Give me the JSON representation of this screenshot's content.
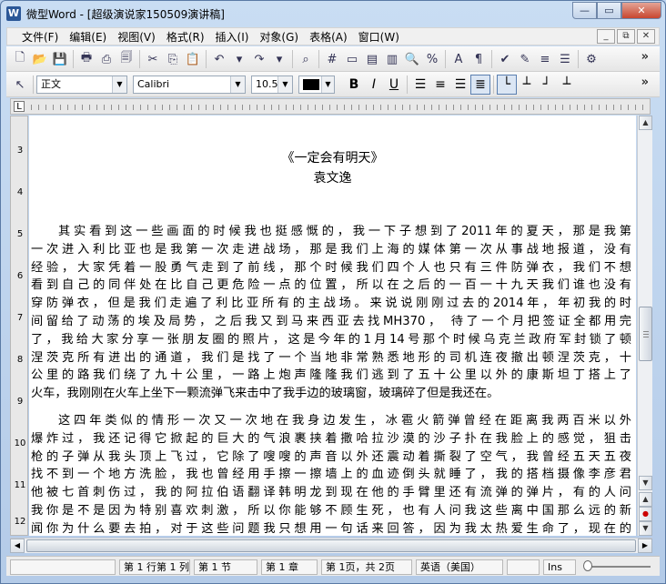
{
  "window": {
    "app_icon": "W",
    "title": "微型Word - [超级演说家150509演讲稿]",
    "controls": {
      "minimize": "—",
      "maximize": "▭",
      "close": "✕"
    }
  },
  "menu": {
    "items": [
      "文件(F)",
      "编辑(E)",
      "视图(V)",
      "格式(R)",
      "插入(I)",
      "对象(G)",
      "表格(A)",
      "窗口(W)"
    ],
    "doc_controls": [
      "_",
      "⧉",
      "✕"
    ]
  },
  "toolbar": {
    "more": "»",
    "style": "正文",
    "font": "Calibri",
    "font_size": "10.5",
    "bold": "B",
    "italic": "I",
    "underline": "U",
    "text_color": "#000000"
  },
  "document": {
    "title": "《一定会有明天》",
    "author": "袁文逸",
    "para1_lines": [
      "其实看到这一些画面的时候我也挺感慨的，我一下子想到了2011年的夏天，那是我第",
      "一次进入利比亚也是我第一次走进战场，那是我们上海的媒体第一次从事战地报道，没有",
      "经验，大家凭着一股勇气走到了前线，那个时候我们四个人也只有三件防弹衣，我们不想",
      "看到自己的同伴处在比自己更危险一点的位置，所以在之后的一百一十九天我们谁也没有",
      "穿防弹衣，但是我们走遍了利比亚所有的主战场。来说说刚刚过去的2014年，年初我的时",
      "间留给了动荡的埃及局势，之后我又到马来西亚去找MH370，  待了一个月把签证全都用完",
      "了，我给大家分享一张朋友圈的照片，这是今年的1月14号那个时候乌克兰政府军封锁了顿",
      "涅茨克所有进出的通道，我们是找了一个当地非常熟悉地形的司机连夜撤出顿涅茨克，十",
      "公里的路我们绕了九十公里，一路上炮声隆隆我们逃到了五十公里以外的康斯坦丁搭上了",
      "火车，我刚刚在火车上坐下一颗流弹飞来击中了我手边的玻璃窗，玻璃碎了但是我还在。"
    ],
    "para2_lines": [
      "这四年类似的情形一次又一次地在我身边发生，冰雹火箭弹曾经在距离我两百米以外",
      "爆炸过，我还记得它掀起的巨大的气浪裹挟着撒哈拉沙漠的沙子扑在我脸上的感觉，狙击",
      "枪的子弹从我头顶上飞过，它除了嗖嗖的声音以外还震动着撕裂了空气，我曾经五天五夜",
      "找不到一个地方洗脸，我也曾经用手擦一擦墙上的血迹倒头就睡了，我的搭档摄像李彦君",
      "他被七首刺伤过，我的阿拉伯语翻译韩明龙到现在他的手臂里还有流弹的弹片，有的人问",
      "我你是不是因为特别喜欢刺激，所以你能够不顾生死，也有人问我这些离中国那么远的新",
      "闻你为什么要去拍，对于这些问题我只想用一句话来回答，因为我太热爱生命了，现在的"
    ],
    "vertical_ruler": [
      "3",
      "4",
      "5",
      "6",
      "7",
      "8",
      "9",
      "10",
      "11",
      "12"
    ]
  },
  "status": {
    "line_col": "第 1 行第 1 列",
    "section": "第 1 节",
    "chapter": "第 1 章",
    "page": "第 1页，共 2页",
    "language": "英语（美国）",
    "mode": "Ins"
  }
}
